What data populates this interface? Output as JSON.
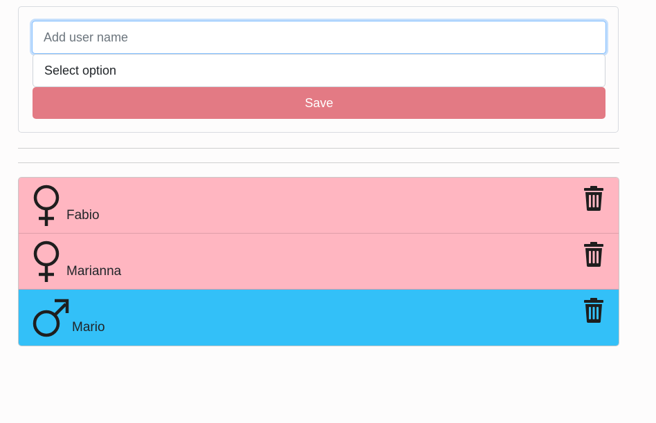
{
  "form": {
    "name_placeholder": "Add user name",
    "select_value": "Select option",
    "save_label": "Save"
  },
  "colors": {
    "female_row": "#ffb6c1",
    "male_row": "#33c0f8",
    "save_button": "#e37a84"
  },
  "users": [
    {
      "name": "Fabio",
      "gender_icon": "female-icon",
      "action_icon": "trash-icon"
    },
    {
      "name": "Marianna",
      "gender_icon": "female-icon",
      "action_icon": "trash-icon"
    },
    {
      "name": "Mario",
      "gender_icon": "male-icon",
      "action_icon": "trash-icon"
    }
  ]
}
